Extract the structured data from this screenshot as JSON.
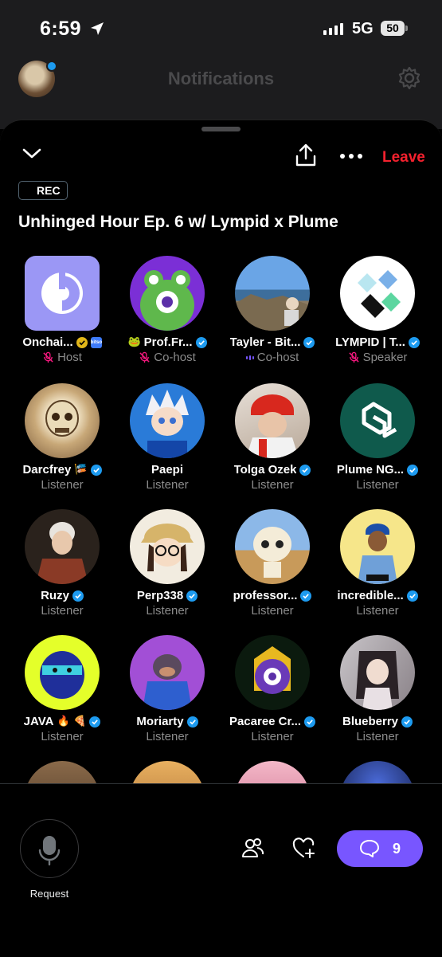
{
  "status_bar": {
    "time": "6:59",
    "network": "5G",
    "battery": "50"
  },
  "background_header": {
    "title": "Notifications"
  },
  "space": {
    "leave_label": "Leave",
    "rec_label": "REC",
    "title": "Unhinged Hour Ep. 6 w/ Lympid x Plume"
  },
  "participants": [
    {
      "name": "Onchai...",
      "role": "Host",
      "muted": true,
      "badge": "gold",
      "extra": "bitso"
    },
    {
      "name": "Prof.Fr...",
      "role": "Co-host",
      "muted": true,
      "badge": "blue",
      "emoji": "🐸"
    },
    {
      "name": "Tayler - Bit...",
      "role": "Co-host",
      "speaking": true,
      "badge": "blue"
    },
    {
      "name": "LYMPID | T...",
      "role": "Speaker",
      "muted": true,
      "badge": "blue"
    },
    {
      "name": "Darcfrey",
      "role": "Listener",
      "badge": "blue",
      "suffix_emoji": "🎏"
    },
    {
      "name": "Paepi",
      "role": "Listener"
    },
    {
      "name": "Tolga Ozek",
      "role": "Listener",
      "badge": "blue"
    },
    {
      "name": "Plume NG...",
      "role": "Listener",
      "badge": "blue"
    },
    {
      "name": "Ruzy",
      "role": "Listener",
      "badge": "blue"
    },
    {
      "name": "Perp338",
      "role": "Listener",
      "badge": "blue"
    },
    {
      "name": "professor...",
      "role": "Listener",
      "badge": "blue"
    },
    {
      "name": "incredible...",
      "role": "Listener",
      "badge": "blue"
    },
    {
      "name": "JAVA",
      "role": "Listener",
      "badge": "blue",
      "suffix_emoji": "🔥 🍕"
    },
    {
      "name": "Moriarty",
      "role": "Listener",
      "badge": "blue"
    },
    {
      "name": "Pacaree Cr...",
      "role": "Listener",
      "badge": "blue"
    },
    {
      "name": "Blueberry",
      "role": "Listener",
      "badge": "blue"
    }
  ],
  "bottom": {
    "request_label": "Request",
    "chat_count": "9"
  },
  "colors": {
    "accent": "#7856ff",
    "leave": "#f4212e",
    "verified": "#1d9bf0",
    "muted_icon": "#f91880"
  }
}
